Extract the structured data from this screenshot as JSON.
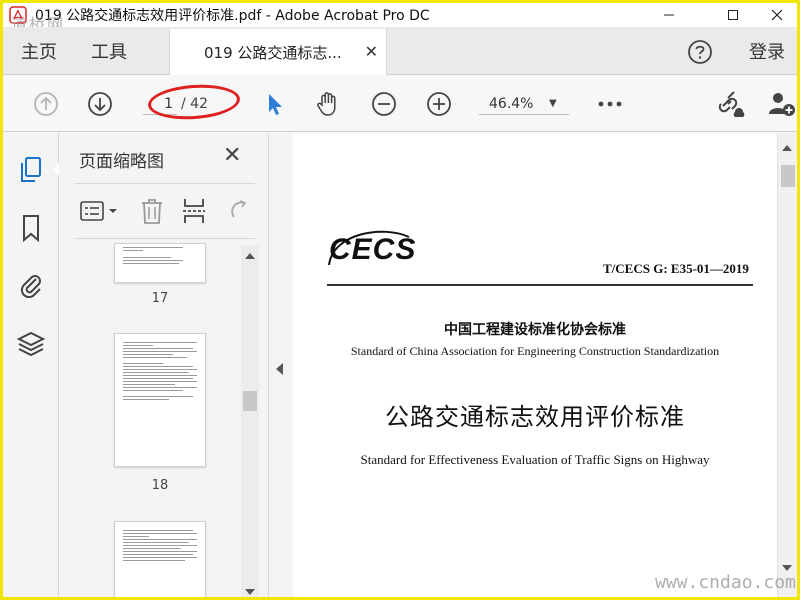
{
  "window": {
    "title": "019 公路交通标志效用评价标准.pdf - Adobe Acrobat Pro DC",
    "controls": [
      "minimize",
      "maximize",
      "close"
    ]
  },
  "watermarks": {
    "top_left": "道桥网",
    "bottom_right": "www.cndao.com"
  },
  "tabs": {
    "home": "主页",
    "tools": "工具",
    "document": "019 公路交通标志...",
    "help_icon": "help-icon",
    "login": "登录"
  },
  "toolbar": {
    "page_current": "1",
    "page_total": "/ 42",
    "zoom": "46.4%",
    "icons": [
      "prev-page-icon",
      "next-page-icon",
      "select-arrow-icon",
      "hand-tool-icon",
      "zoom-out-icon",
      "zoom-in-icon",
      "more-icon",
      "share-link-icon",
      "add-user-icon"
    ]
  },
  "sidebar": {
    "icons": [
      "page-thumbnails-icon",
      "bookmark-icon",
      "attachment-icon",
      "layers-icon"
    ]
  },
  "thumbnails_panel": {
    "title": "页面缩略图",
    "pages": [
      {
        "number": "17"
      },
      {
        "number": "18"
      },
      {
        "number": ""
      }
    ]
  },
  "document": {
    "logo": "CECS",
    "standard_code": "T/CECS G: E35-01—2019",
    "association_cn": "中国工程建设标准化协会标准",
    "association_en": "Standard of China Association for Engineering Construction Standardization",
    "title_cn": "公路交通标志效用评价标准",
    "title_en": "Standard for Effectiveness Evaluation of Traffic Signs on Highway"
  },
  "colors": {
    "accent_blue": "#1a73c8",
    "annotation_red": "#e02020",
    "border_yellow": "#f2e600"
  }
}
